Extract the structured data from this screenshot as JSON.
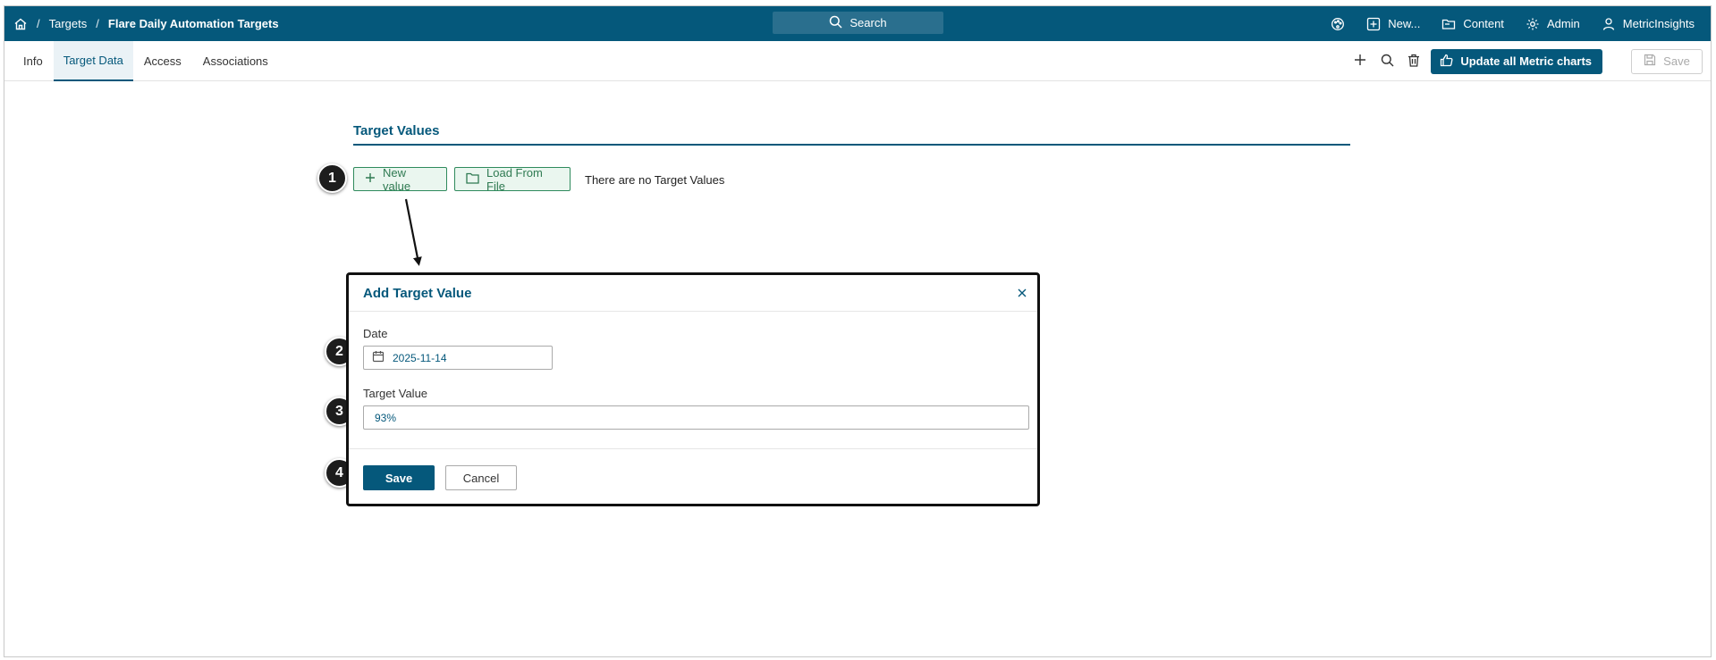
{
  "breadcrumb": {
    "home_icon": "home-icon",
    "separator": "/",
    "items": [
      "Targets",
      "Flare Daily Automation Targets"
    ]
  },
  "search": {
    "label": "Search",
    "icon": "search-icon"
  },
  "topnav": {
    "items": [
      {
        "label": "",
        "icon": "palette-icon"
      },
      {
        "label": "New...",
        "icon": "plus-square-icon"
      },
      {
        "label": "Content",
        "icon": "folder-icon"
      },
      {
        "label": "Admin",
        "icon": "gear-icon"
      },
      {
        "label": "MetricInsights",
        "icon": "user-icon"
      }
    ]
  },
  "tabs": [
    {
      "label": "Info",
      "active": false
    },
    {
      "label": "Target Data",
      "active": true
    },
    {
      "label": "Access",
      "active": false
    },
    {
      "label": "Associations",
      "active": false
    }
  ],
  "toolbar": {
    "update_label": "Update all Metric charts",
    "save_label": "Save"
  },
  "section": {
    "title": "Target Values",
    "new_value_label": "New value",
    "load_from_file_label": "Load From File",
    "empty_text": "There are no Target Values"
  },
  "dialog": {
    "title": "Add Target Value",
    "date_label": "Date",
    "date_value": "2025-11-14",
    "target_value_label": "Target Value",
    "target_value": "93%",
    "save_label": "Save",
    "cancel_label": "Cancel"
  },
  "annotations": [
    "1",
    "2",
    "3",
    "4"
  ],
  "colors": {
    "brand": "#05587b",
    "green_border": "#2f8a5c",
    "badge": "#1d1d1d"
  }
}
